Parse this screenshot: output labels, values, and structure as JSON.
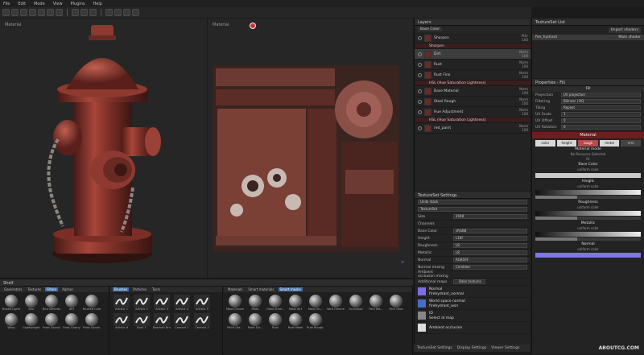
{
  "menu": [
    "File",
    "Edit",
    "Mode",
    "View",
    "Plugins",
    "Help"
  ],
  "viewport3d": {
    "label": "Material"
  },
  "viewport2d": {
    "label": "Material"
  },
  "layers": {
    "title": "Layers",
    "channel": "Base Color",
    "rows": [
      {
        "name": "Sharpen",
        "blend": "Pthr",
        "op": "100",
        "type": "layer"
      },
      {
        "name": "Sharpen",
        "type": "fx"
      },
      {
        "name": "Dirt",
        "blend": "Norm",
        "op": "100",
        "type": "layer",
        "selected": true
      },
      {
        "name": "Rust",
        "blend": "Norm",
        "op": "100",
        "type": "layer"
      },
      {
        "name": "Rust Fine",
        "blend": "Norm",
        "op": "100",
        "type": "layer"
      },
      {
        "name": "HSL (Hue Saturation Lightness)",
        "type": "fx"
      },
      {
        "name": "Base Material",
        "blend": "Norm",
        "op": "100",
        "type": "layer"
      },
      {
        "name": "Steel Rough",
        "blend": "Norm",
        "op": "100",
        "type": "layer"
      },
      {
        "name": "Hue Adjustment",
        "blend": "Norm",
        "op": "100",
        "type": "layer"
      },
      {
        "name": "HSL (Hue Saturation Lightness)",
        "type": "fx"
      },
      {
        "name": "red_paint",
        "blend": "Norm",
        "op": "100",
        "type": "layer"
      }
    ]
  },
  "texture_set_settings": {
    "title": "TextureSet Settings",
    "undo": "Undo stack",
    "texset": "TextureSet",
    "size_label": "Size",
    "size": "2048",
    "channels_label": "Channels",
    "channels": [
      {
        "name": "Base Color",
        "format": "sRGB8"
      },
      {
        "name": "Height",
        "format": "L16F"
      },
      {
        "name": "Roughness",
        "format": "L8"
      },
      {
        "name": "Metallic",
        "format": "L8"
      },
      {
        "name": "Normal",
        "format": "RGB16F"
      }
    ],
    "normal_mixing_label": "Normal mixing",
    "normal_mixing": "Combine",
    "ao_mixing_label": "Ambient occlusion mixing",
    "additional_label": "Additional maps",
    "bake_button": "Bake textures",
    "maps": [
      {
        "name": "Normal",
        "file": "firehydrant_normal",
        "color": "#7b6ee6"
      },
      {
        "name": "World space normal",
        "file": "firehydrant_wsn",
        "color": "#4a6bc8"
      },
      {
        "name": "ID",
        "file": "Select id map",
        "color": "#888888"
      },
      {
        "name": "Ambient occlusion",
        "file": "",
        "color": "#dddddd"
      }
    ]
  },
  "bottom_tabs": [
    "TextureSet Settings",
    "Display Settings",
    "Viewer Settings"
  ],
  "textureset_list": {
    "title": "TextureSet List",
    "import_label": "Import shaders",
    "item": "fire_hydrant",
    "shader": "Main shader"
  },
  "properties": {
    "title": "Properties - Fill",
    "fill": "Fill",
    "rows": [
      {
        "label": "Projection",
        "value": "UV projection"
      },
      {
        "label": "Filtering",
        "value": "Bilinear | HQ"
      },
      {
        "label": "Tiling",
        "value": "Repeat"
      },
      {
        "label": "UV Scale",
        "value": "1"
      },
      {
        "label": "UV Offset",
        "value": "0"
      },
      {
        "label": "UV Rotation",
        "value": "0"
      }
    ],
    "material_title": "Material",
    "channels": [
      "color",
      "height",
      "rough",
      "metal",
      "nrm"
    ],
    "material_mode": "Material mode",
    "no_resource": "No Resource Selected",
    "or": "Or",
    "sections": [
      {
        "name": "Base Color",
        "sub": "uniform color"
      },
      {
        "name": "Height",
        "sub": "uniform color"
      },
      {
        "name": "Roughness",
        "sub": "uniform color"
      },
      {
        "name": "Metallic",
        "sub": "uniform color"
      },
      {
        "name": "Normal",
        "sub": "uniform color"
      }
    ]
  },
  "shelf": {
    "title": "Shelf",
    "left_tabs": [
      "Generators",
      "Textures",
      "Filters",
      "Alphas"
    ],
    "left_items": [
      "Baked Lighti...",
      "Blur",
      "Blur Directio...",
      "dirt",
      "Blurred Color",
      "Warp",
      "Lightweight",
      "Frost Gaussi...",
      "Frost Grainy",
      "Frost Gauss..."
    ],
    "mid_tabs": [
      "Brushes",
      "Particles",
      "Tools"
    ],
    "mid_items": [
      "Artistic 1",
      "Artistic 2",
      "Artistic 3",
      "Artistic 4",
      "Artistic 5",
      "Artistic 6",
      "Bark 1",
      "Basmati Brush",
      "Cement 1",
      "Cement 2"
    ],
    "right_tabs": [
      "Materials",
      "Smart materials",
      "Smart masks"
    ],
    "right_items": [
      "Moss Ground",
      "Moss",
      "Glass from...",
      "Moss dirt",
      "Moss Sh...",
      "Vent Concrete",
      "Occlusion",
      "Fern Ma...",
      "Fern Glue",
      "Paint Glo...",
      "Paint Dir...",
      "Rust",
      "Rust Mask",
      "Rust Rough..."
    ]
  },
  "watermark": "ABOUTCG.COM"
}
